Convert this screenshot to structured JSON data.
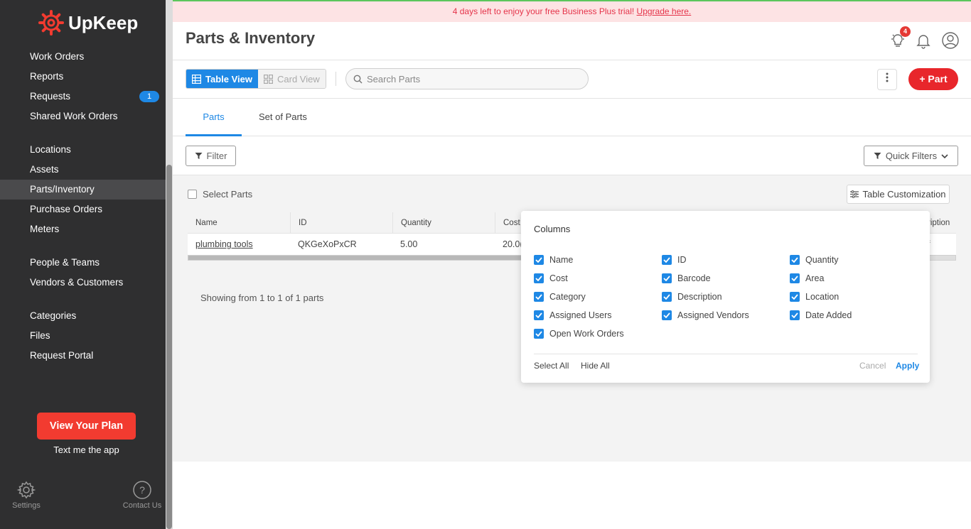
{
  "brand": {
    "name": "UpKeep",
    "color": "#f23b30",
    "icon": "gear-logo-icon"
  },
  "sidebar": {
    "groups": [
      [
        {
          "label": "Work Orders"
        },
        {
          "label": "Reports"
        },
        {
          "label": "Requests",
          "badge": "1"
        },
        {
          "label": "Shared Work Orders"
        }
      ],
      [
        {
          "label": "Locations"
        },
        {
          "label": "Assets"
        },
        {
          "label": "Parts/Inventory",
          "active": true
        },
        {
          "label": "Purchase Orders"
        },
        {
          "label": "Meters"
        }
      ],
      [
        {
          "label": "People & Teams"
        },
        {
          "label": "Vendors & Customers"
        }
      ],
      [
        {
          "label": "Categories"
        },
        {
          "label": "Files"
        },
        {
          "label": "Request Portal"
        }
      ]
    ],
    "plan_button": "View Your Plan",
    "text_app": "Text me the app",
    "settings_label": "Settings",
    "contact_label": "Contact Us"
  },
  "banner": {
    "text": "4 days left to enjoy your free Business Plus trial! ",
    "link": "Upgrade here."
  },
  "header": {
    "title": "Parts & Inventory",
    "notifications_count": "4"
  },
  "toolbar": {
    "table_view": "Table View",
    "card_view": "Card View",
    "search_placeholder": "Search Parts",
    "add_button": "+ Part"
  },
  "tabs": [
    {
      "label": "Parts",
      "active": true
    },
    {
      "label": "Set of Parts",
      "active": false
    }
  ],
  "filters": {
    "filter_label": "Filter",
    "quick_filters_label": "Quick Filters"
  },
  "table": {
    "select_label": "Select Parts",
    "customization_label": "Table Customization",
    "columns": [
      "Name",
      "ID",
      "Quantity",
      "Cost",
      "ription"
    ],
    "rows": [
      {
        "name": "plumbing tools",
        "id": "QKGeXoPxCR",
        "quantity": "5.00",
        "cost": "20.0(",
        "trailing": "f"
      }
    ],
    "showing": "Showing from 1 to 1 of 1 parts"
  },
  "columns_popup": {
    "title": "Columns",
    "options": [
      {
        "label": "Name",
        "checked": true
      },
      {
        "label": "ID",
        "checked": true
      },
      {
        "label": "Quantity",
        "checked": true
      },
      {
        "label": "Cost",
        "checked": true
      },
      {
        "label": "Barcode",
        "checked": true
      },
      {
        "label": "Area",
        "checked": true
      },
      {
        "label": "Category",
        "checked": true
      },
      {
        "label": "Description",
        "checked": true
      },
      {
        "label": "Location",
        "checked": true
      },
      {
        "label": "Assigned Users",
        "checked": true
      },
      {
        "label": "Assigned Vendors",
        "checked": true
      },
      {
        "label": "Date Added",
        "checked": true
      },
      {
        "label": "Open Work Orders",
        "checked": true
      }
    ],
    "select_all": "Select All",
    "hide_all": "Hide All",
    "cancel": "Cancel",
    "apply": "Apply"
  },
  "colors": {
    "accent": "#1e88e5",
    "danger": "#e8262b",
    "sidebar_bg": "#2f2f30"
  }
}
